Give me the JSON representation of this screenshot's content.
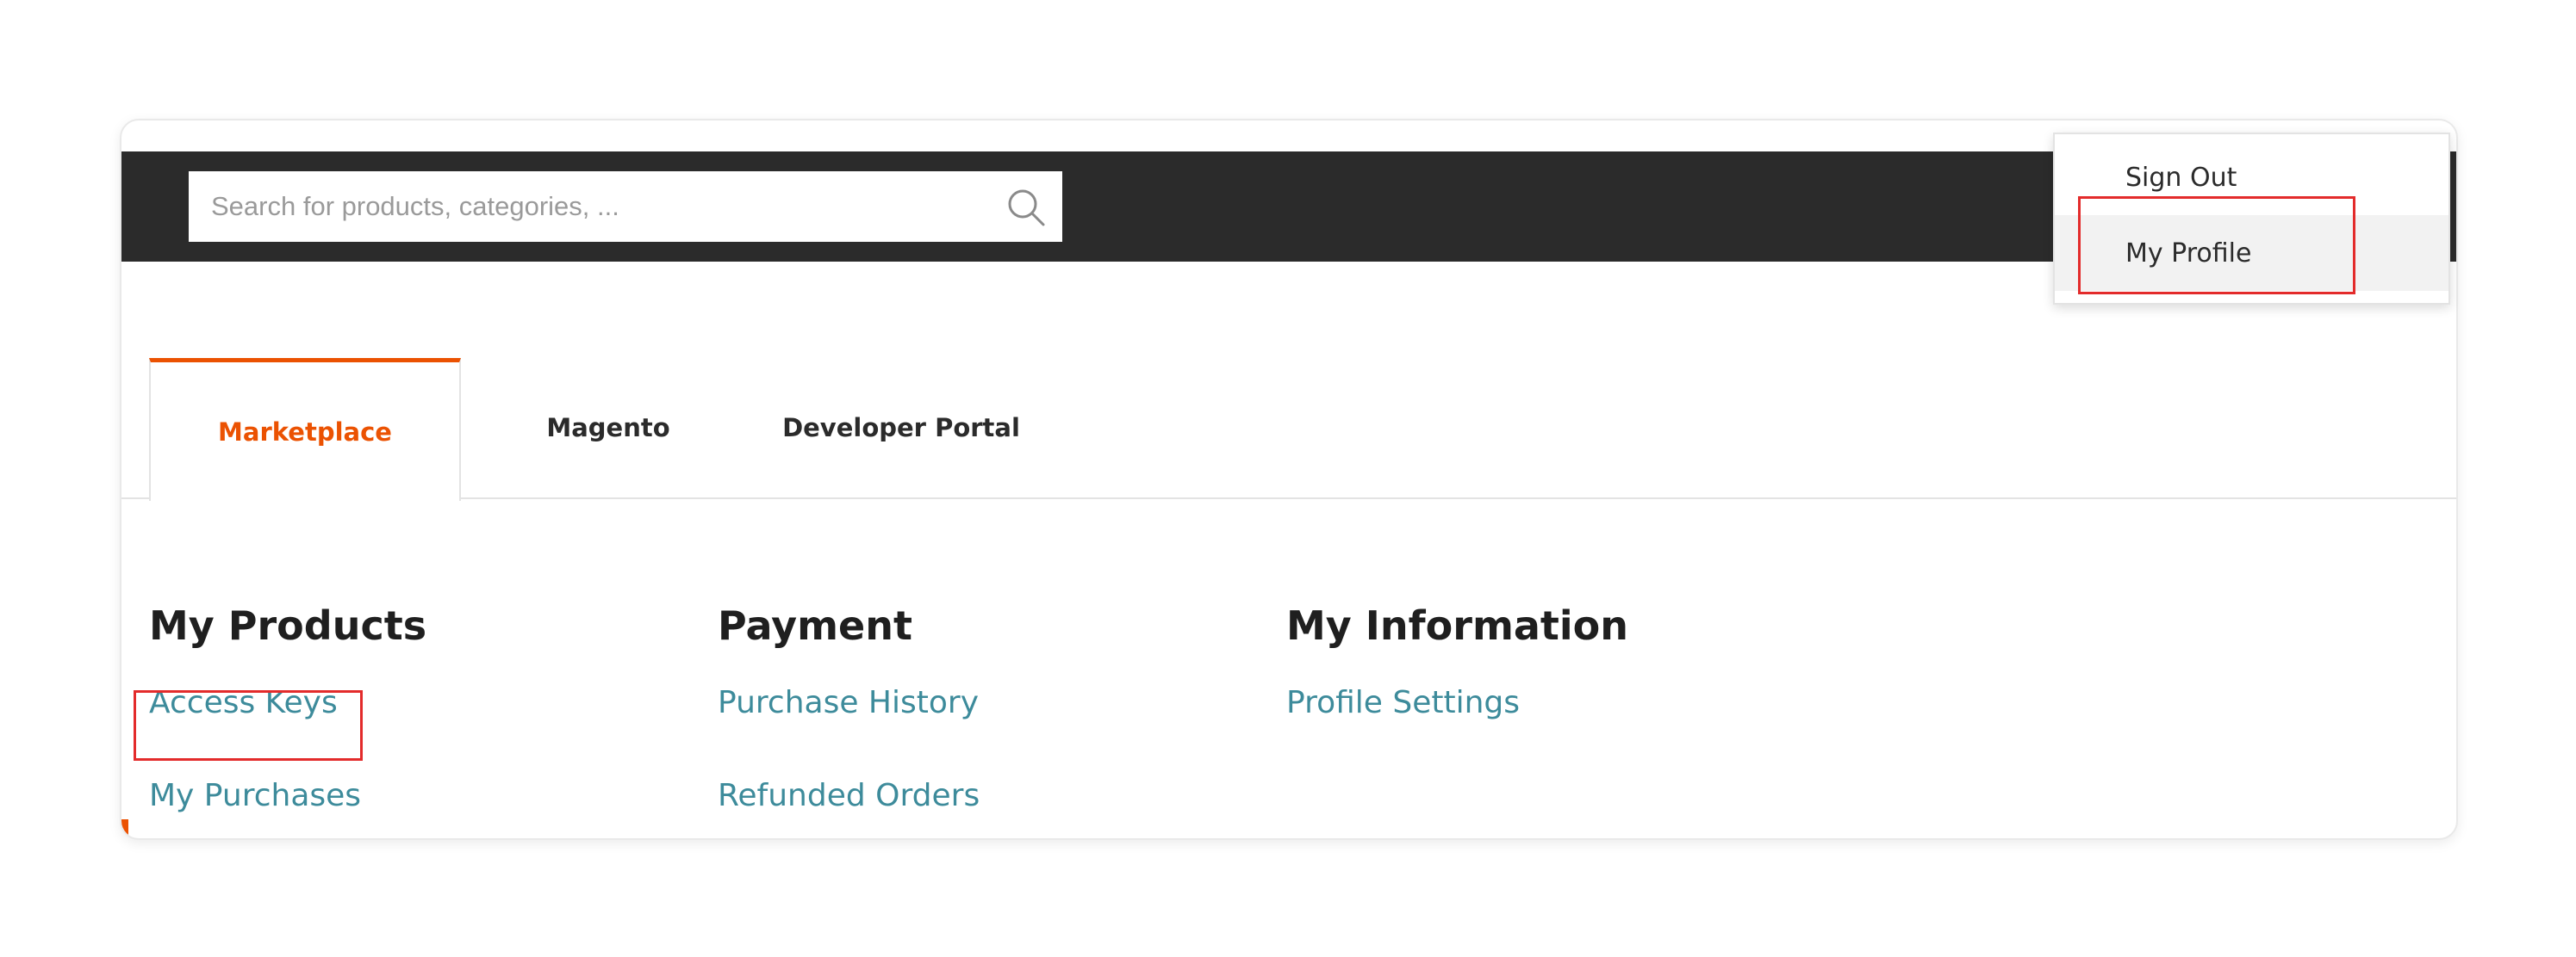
{
  "search": {
    "placeholder": "Search for products, categories, ...",
    "icon": "search-icon"
  },
  "tabs": [
    {
      "label": "Marketplace",
      "active": true
    },
    {
      "label": "Magento",
      "active": false
    },
    {
      "label": "Developer Portal",
      "active": false
    }
  ],
  "sections": [
    {
      "heading": "My Products",
      "links": [
        "Access Keys",
        "My Purchases"
      ]
    },
    {
      "heading": "Payment",
      "links": [
        "Purchase History",
        "Refunded Orders"
      ]
    },
    {
      "heading": "My Information",
      "links": [
        "Profile Settings"
      ]
    }
  ],
  "account_menu": {
    "items": [
      "Sign Out",
      "My Profile"
    ]
  },
  "colors": {
    "accent": "#eb5202",
    "link": "#3d8b9b",
    "topbar": "#2b2b2b",
    "highlight": "#e32b2b"
  }
}
